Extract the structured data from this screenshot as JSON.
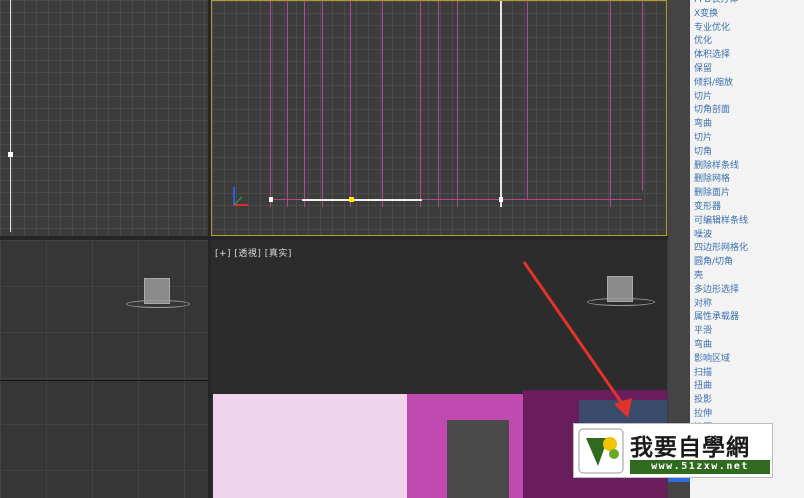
{
  "perspective_viewport": {
    "label": "[+] [透視] [真实]"
  },
  "modifier_list": {
    "items": [
      "FFD长方体",
      "X变换",
      "专业优化",
      "优化",
      "体积选择",
      "保留",
      "倾斜/缩放",
      "切片",
      "切角剖面",
      "弯曲",
      "切片",
      "切角",
      "删除样条线",
      "删除网格",
      "删除面片",
      "变形器",
      "可编辑样条线",
      "噪波",
      "四边形网格化",
      "圆角/切角",
      "壳",
      "多边形选择",
      "对称",
      "属性承载器",
      "平滑",
      "弯曲",
      "影响区域",
      "扫描",
      "扭曲",
      "投影",
      "拉伸",
      "挤压"
    ]
  },
  "watermark": {
    "title": "我要自學網",
    "url": "www.51zxw.net"
  },
  "colors": {
    "accent_red": "#e0332c",
    "shape_pink_light": "#f0d4ee",
    "shape_magenta": "#c04ab0",
    "shape_purple": "#6a1d5c",
    "active_border": "#b59a2c"
  }
}
